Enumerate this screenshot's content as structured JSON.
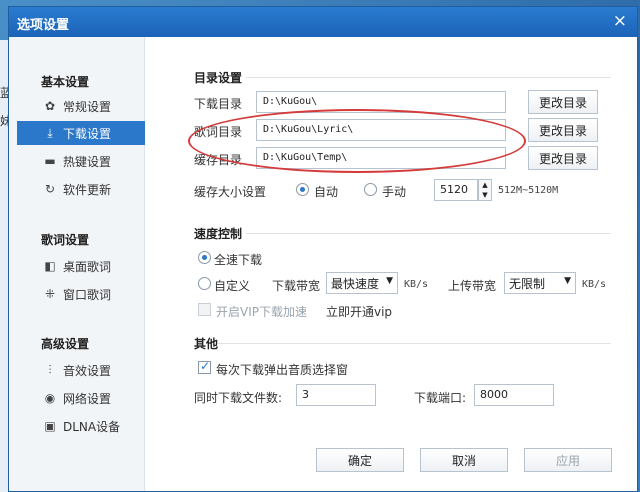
{
  "window": {
    "title": "选项设置",
    "close_symbol": "×"
  },
  "background": {
    "fragments": [
      "蓝",
      "妹"
    ]
  },
  "sidebar": {
    "sections": [
      {
        "title": "基本设置",
        "items": [
          {
            "label": "常规设置",
            "icon": "gear-icon",
            "glyph": "✿",
            "active": false
          },
          {
            "label": "下载设置",
            "icon": "download-icon",
            "glyph": "⤓",
            "active": true
          },
          {
            "label": "热键设置",
            "icon": "keyboard-icon",
            "glyph": "▬",
            "active": false
          },
          {
            "label": "软件更新",
            "icon": "refresh-icon",
            "glyph": "↻",
            "active": false
          }
        ]
      },
      {
        "title": "歌词设置",
        "items": [
          {
            "label": "桌面歌词",
            "icon": "desktop-lyric-icon",
            "glyph": "◧",
            "active": false
          },
          {
            "label": "窗口歌词",
            "icon": "window-lyric-icon",
            "glyph": "⁜",
            "active": false
          }
        ]
      },
      {
        "title": "高级设置",
        "items": [
          {
            "label": "音效设置",
            "icon": "equalizer-icon",
            "glyph": "⫶",
            "active": false
          },
          {
            "label": "网络设置",
            "icon": "network-icon",
            "glyph": "◉",
            "active": false
          },
          {
            "label": "DLNA设备",
            "icon": "dlna-icon",
            "glyph": "▣",
            "active": false
          }
        ]
      }
    ]
  },
  "directory": {
    "title": "目录设置",
    "download_label": "下载目录",
    "download_path": "D:\\KuGou\\",
    "lyric_label": "歌词目录",
    "lyric_path": "D:\\KuGou\\Lyric\\",
    "cache_label": "缓存目录",
    "cache_path": "D:\\KuGou\\Temp\\",
    "change_button": "更改目录",
    "cache_size_label": "缓存大小设置",
    "auto_label": "自动",
    "manual_label": "手动",
    "cache_size_value": "5120",
    "cache_range": "512M~5120M"
  },
  "speed": {
    "title": "速度控制",
    "full_speed_label": "全速下载",
    "custom_label": "自定义",
    "download_bw_label": "下载带宽",
    "download_bw_value": "最快速度",
    "upload_bw_label": "上传带宽",
    "upload_bw_value": "无限制",
    "unit": "KB/s",
    "vip_label": "开启VIP下载加速",
    "vip_link": "立即开通vip"
  },
  "other": {
    "title": "其他",
    "quality_popup_label": "每次下载弹出音质选择窗",
    "concurrent_label": "同时下载文件数:",
    "concurrent_value": "3",
    "port_label": "下载端口:",
    "port_value": "8000"
  },
  "footer": {
    "ok": "确定",
    "cancel": "取消",
    "apply": "应用"
  },
  "colors": {
    "accent": "#2b77c9",
    "annotation": "#d43b3b"
  }
}
